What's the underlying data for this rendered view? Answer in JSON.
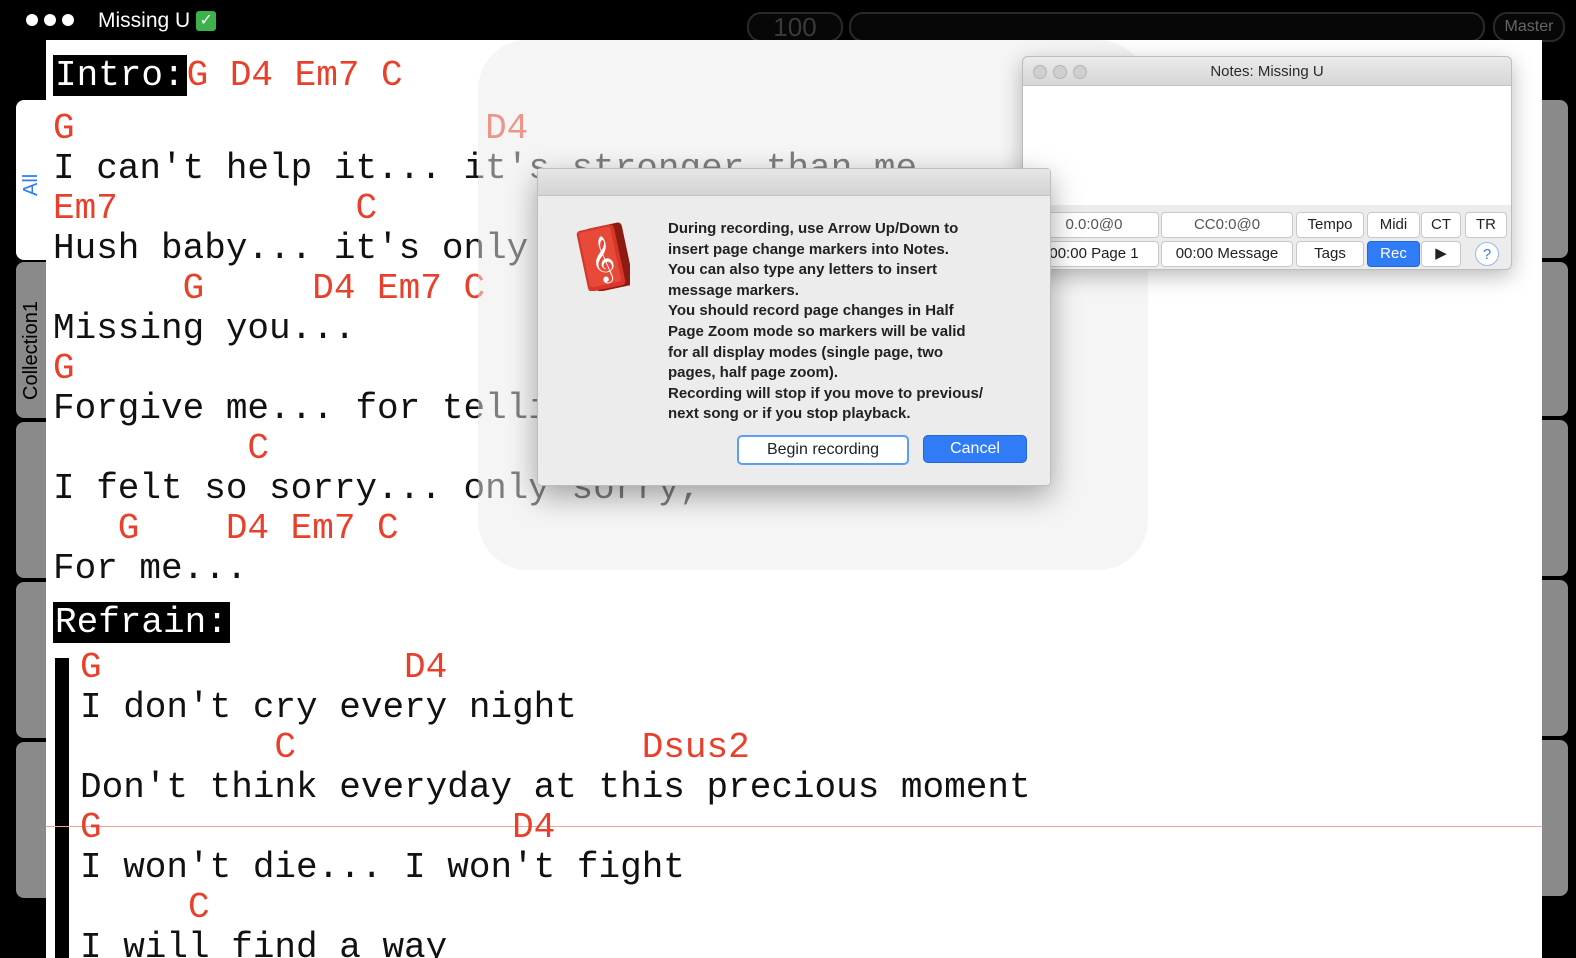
{
  "window": {
    "title": "Missing U",
    "tempo": "100",
    "master_label": "Master"
  },
  "side_tabs": {
    "all_label": "All",
    "collection_label": "Collection1"
  },
  "song": {
    "intro_label": "Intro:",
    "intro_chords": "G D4 Em7 C",
    "verse": [
      {
        "chords": "G                   D4",
        "lyric": "I can't help it... it's stronger than me"
      },
      {
        "chords": "Em7           C",
        "lyric": "Hush baby... it's only"
      },
      {
        "chords": "      G     D4 Em7 C",
        "lyric": "Missing you..."
      },
      {
        "chords": "G",
        "lyric": "Forgive me... for telli"
      },
      {
        "chords": "         C",
        "lyric": "I felt so sorry... only sorry,"
      },
      {
        "chords": "   G    D4 Em7 C",
        "lyric": "For me..."
      }
    ],
    "refrain_label": "Refrain:",
    "refrain": [
      {
        "chords": "G              D4",
        "lyric": "I don't cry every night"
      },
      {
        "chords": "         C                Dsus2",
        "lyric": "Don't think everyday at this precious moment"
      },
      {
        "chords": "G                   D4",
        "lyric": "I won't die... I won't fight"
      },
      {
        "chords": "     C",
        "lyric": "I will find a way"
      }
    ]
  },
  "notes_window": {
    "title": "Notes: Missing U",
    "field_position": "0.0:0@0",
    "field_cc": "CC0:0@0",
    "tempo_label": "Tempo",
    "midi_label": "Midi",
    "ct_label": "CT",
    "tr_label": "TR",
    "field_page": "00:00 Page 1",
    "field_message": "00:00 Message",
    "tags_label": "Tags",
    "rec_label": "Rec",
    "play_label": "▶",
    "help_label": "?"
  },
  "dialog": {
    "message_lines": [
      "During recording, use Arrow Up/Down to",
      "insert page change markers into Notes.",
      "You can also type any letters to insert",
      "message markers.",
      "You should record page changes in Half",
      "Page Zoom mode so markers will be valid",
      "for all display modes (single page, two",
      "pages, half page zoom).",
      "Recording will stop if you move to previous/",
      "next song or if you stop playback."
    ],
    "begin_label": "Begin recording",
    "cancel_label": "Cancel",
    "icon": "songbook-icon"
  },
  "colors": {
    "chord": "#e8402b",
    "accent": "#2f7cf6"
  }
}
